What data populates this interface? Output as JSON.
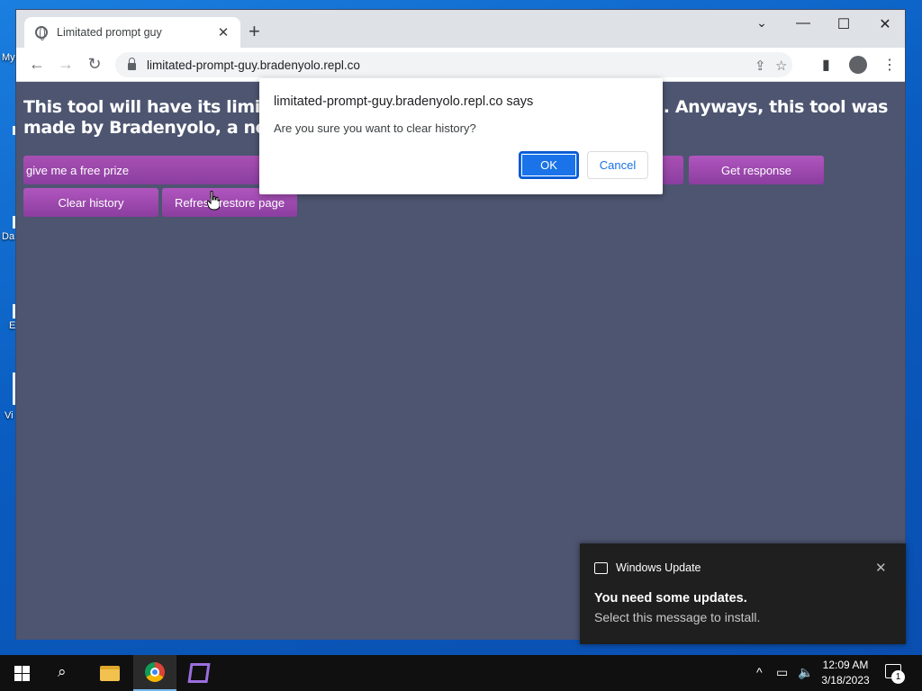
{
  "desktop": {
    "icon_labels": [
      "My",
      "Da",
      "E",
      "Vi"
    ]
  },
  "browser": {
    "tab_title": "Limitated prompt guy",
    "new_tab": "+",
    "url": "limitated-prompt-guy.bradenyolo.repl.co"
  },
  "page": {
    "heading": "This tool will have its limitations, it could be pretty limited in some cases. It might also have a lot of things missing. Anyways, this tool was made by Bradenyolo, a newbie",
    "heading_visible_left_1": "This tool will have its limitation",
    "heading_visible_right_1": "king. Anyways, this tool was",
    "heading_visible_left_2": "made by Bradenyolo, a newbie",
    "input_value": "give me a free prize",
    "buttons": {
      "get_response": "Get response",
      "clear_history": "Clear history",
      "refresh": "Refresh/restore page"
    }
  },
  "dialog": {
    "title": "limitated-prompt-guy.bradenyolo.repl.co says",
    "message": "Are you sure you want to clear history?",
    "ok": "OK",
    "cancel": "Cancel"
  },
  "toast": {
    "app": "Windows Update",
    "title": "You need some updates.",
    "body": "Select this message to install."
  },
  "taskbar": {
    "time": "12:09 AM",
    "date": "3/18/2023",
    "notification_count": "1",
    "pinned": [
      "File Explorer",
      "Google Chrome",
      "Visual Studio"
    ],
    "active_app": "Google Chrome"
  },
  "colors": {
    "page_bg": "#4d5570",
    "button_purple": "#a94fb4",
    "dialog_ok": "#1a73e8"
  }
}
